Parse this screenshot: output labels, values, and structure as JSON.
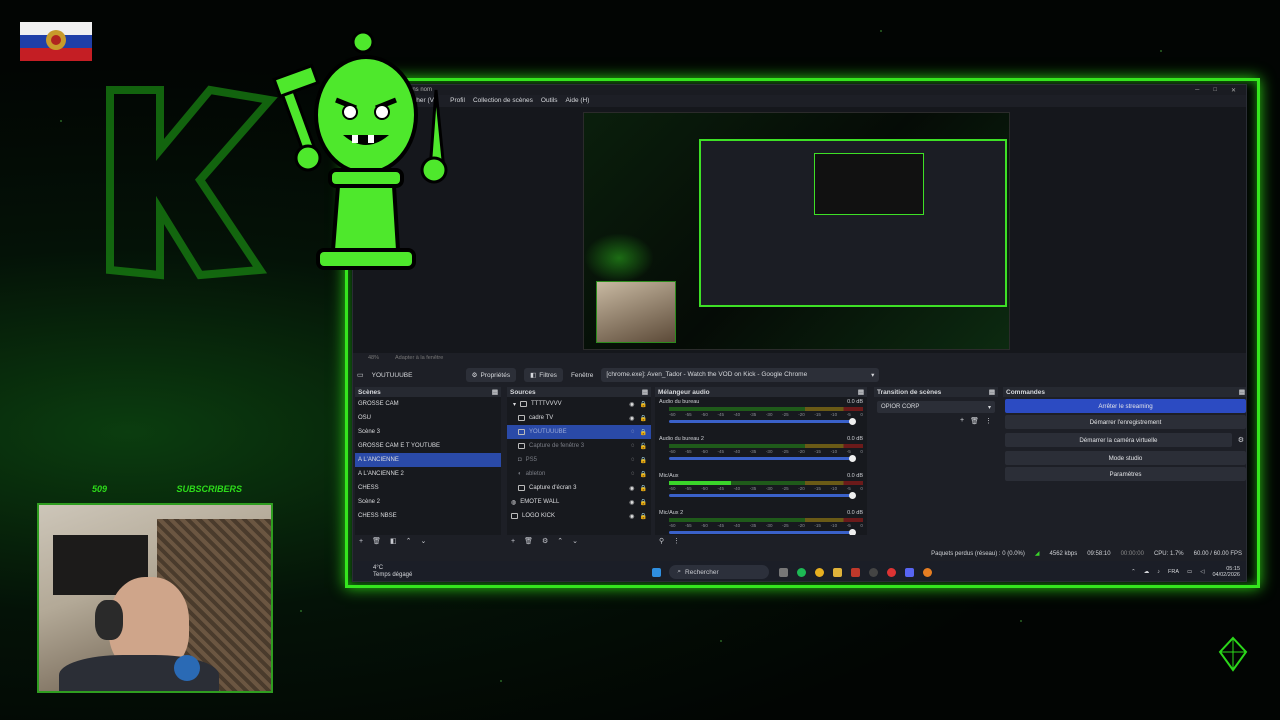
{
  "obs": {
    "title": "Sans nom",
    "menu": [
      "Profil",
      "Collection de scènes",
      "Outils",
      "Aide (H)"
    ],
    "menu_partial": "cher (V)",
    "preview_status": {
      "zoom": "48%",
      "fit": "Adapter à la fenêtre"
    },
    "source_bar": {
      "current_source": "YOUTUUUBE",
      "properties": "Propriétés",
      "filters": "Filtres",
      "window_label": "Fenêtre",
      "window_value": "[chrome.exe]: Aven_Tador - Watch the VOD on Kick - Google Chrome"
    },
    "scenes": {
      "title": "Scènes",
      "items": [
        "GROSSE CAM",
        "OSU",
        "Scène 3",
        "GROSSE CAM E T YOUTUBE",
        "A L'ANCIENNE",
        "A L'ANCIENNE 2",
        "CHESS",
        "Scène 2",
        "CHESS NBSE"
      ],
      "selected": "A L'ANCIENNE"
    },
    "sources": {
      "title": "Sources",
      "items": [
        {
          "label": "TTTTVVVV",
          "state": "group"
        },
        {
          "label": "cadre TV",
          "state": "normal"
        },
        {
          "label": "YOUTUUUBE",
          "state": "selected"
        },
        {
          "label": "Capture de fenêtre 3",
          "state": "dim"
        },
        {
          "label": "PS5",
          "state": "dim"
        },
        {
          "label": "ableton",
          "state": "dim"
        },
        {
          "label": "Capture d'écran 3",
          "state": "normal"
        },
        {
          "label": "EMOTE WALL",
          "state": "normal"
        },
        {
          "label": "LOGO KICK",
          "state": "normal"
        }
      ]
    },
    "mixer": {
      "title": "Mélangeur audio",
      "channels": [
        {
          "name": "Audio du bureau",
          "db": "0.0 dB",
          "level": 0
        },
        {
          "name": "Audio du bureau 2",
          "db": "0.0 dB",
          "level": 0
        },
        {
          "name": "Mic/Aux",
          "db": "0.0 dB",
          "level": 0.32
        },
        {
          "name": "Mic/Aux 2",
          "db": "0.0 dB",
          "level": 0
        }
      ],
      "scale": [
        "-60",
        "-55",
        "-50",
        "-45",
        "-40",
        "-35",
        "-30",
        "-25",
        "-20",
        "-15",
        "-10",
        "-5",
        "0"
      ]
    },
    "transitions": {
      "title": "Transition de scènes",
      "value": "OPIOR CORP"
    },
    "commands": {
      "title": "Commandes",
      "stop_streaming": "Arrêter le streaming",
      "start_recording": "Démarrer l'enregistrement",
      "start_virtual_cam": "Démarrer la caméra virtuelle",
      "studio_mode": "Mode studio",
      "settings": "Paramètres"
    },
    "status": {
      "dropped": "Paquets perdus (réseau) : 0 (0.0%)",
      "bitrate": "4562 kbps",
      "stream_time": "09:58:10",
      "rec_time": "00:00:00",
      "cpu": "CPU: 1.7%",
      "fps": "60.00 / 60.00 FPS"
    }
  },
  "taskbar": {
    "temp": "4°C",
    "weather": "Temps dégagé",
    "search": "Rechercher",
    "lang": "FRA",
    "time": "05:15",
    "date": "04/02/2026"
  },
  "overlay": {
    "sub_count": "509",
    "sub_label": "SUBSCRIBERS"
  },
  "colors": {
    "accent": "#35e51e",
    "obs_bg": "#1d1f26",
    "selected": "#2a4aa8",
    "primary_button": "#2c4bc2"
  }
}
